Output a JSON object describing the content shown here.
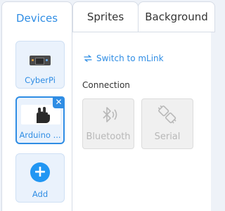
{
  "tabs": [
    {
      "label": "Devices",
      "active": true
    },
    {
      "label": "Sprites",
      "active": false
    },
    {
      "label": "Background",
      "active": false
    }
  ],
  "devices": [
    {
      "label": "CyberPi",
      "icon": "cyberpi-board-icon"
    },
    {
      "label": "Arduino ...",
      "icon": "arduino-hand-icon",
      "selected": true
    }
  ],
  "add_device": {
    "label": "Add",
    "icon": "plus-icon"
  },
  "switch_link": {
    "label": "Switch to mLink",
    "icon": "swap-arrows-icon"
  },
  "connection": {
    "heading": "Connection",
    "options": [
      {
        "label": "Bluetooth",
        "icon": "bluetooth-icon"
      },
      {
        "label": "Serial",
        "icon": "usb-cable-icon"
      }
    ]
  },
  "colors": {
    "accent": "#2f8de4",
    "disabled": "#b8b8b8",
    "panel_bg": "#eef2f8"
  }
}
